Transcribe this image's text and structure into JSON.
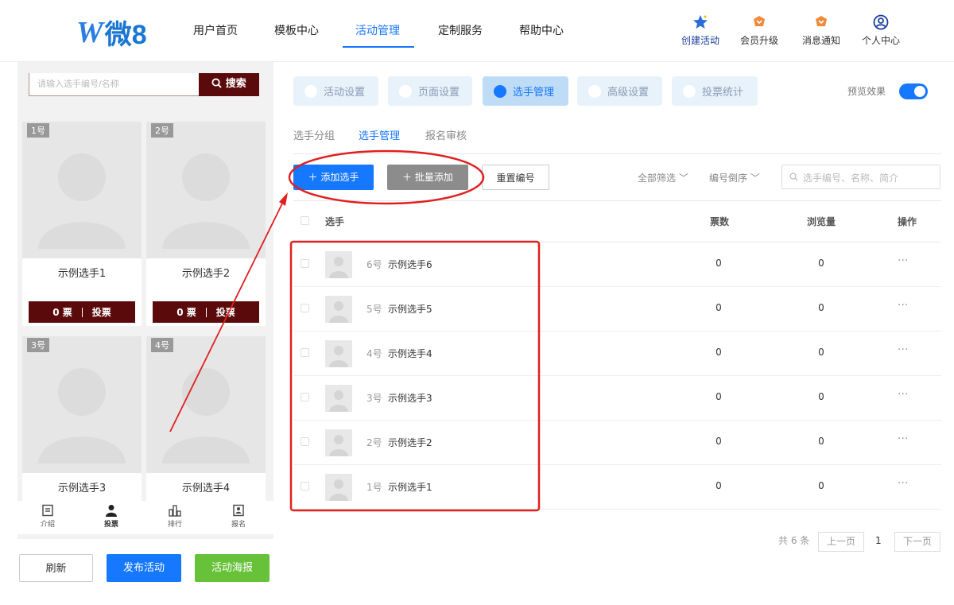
{
  "header": {
    "logo_w": "W",
    "logo_text": "微8",
    "nav": [
      "用户首页",
      "模板中心",
      "活动管理",
      "定制服务",
      "帮助中心"
    ],
    "active_nav": "活动管理",
    "icons": [
      {
        "label": "创建活动",
        "icon": "star-icon"
      },
      {
        "label": "会员升级",
        "icon": "crown-icon"
      },
      {
        "label": "消息通知",
        "icon": "bell-icon"
      },
      {
        "label": "个人中心",
        "icon": "user-icon"
      }
    ]
  },
  "preview": {
    "search_placeholder": "请输入选手编号/名称",
    "search_button": "搜索",
    "cards": [
      {
        "num": "1号",
        "name": "示例选手1",
        "votes": "0 票",
        "action": "投票"
      },
      {
        "num": "2号",
        "name": "示例选手2",
        "votes": "0 票",
        "action": "投票"
      },
      {
        "num": "3号",
        "name": "示例选手3"
      },
      {
        "num": "4号",
        "name": "示例选手4"
      }
    ],
    "bottom_nav": [
      "介绍",
      "投票",
      "排行",
      "报名"
    ],
    "active_bottom": "投票"
  },
  "left_actions": {
    "refresh": "刷新",
    "publish": "发布活动",
    "poster": "活动海报"
  },
  "tabs": [
    "活动设置",
    "页面设置",
    "选手管理",
    "高级设置",
    "投票统计"
  ],
  "active_tab": "选手管理",
  "preview_label": "预览效果",
  "subtabs": [
    "选手分组",
    "选手管理",
    "报名审核"
  ],
  "actions": {
    "add": "＋ 添加选手",
    "batch": "＋ 批量添加",
    "reset": "重置编号",
    "filter": "全部筛选 ﹀",
    "sort": "编号倒序 ﹀",
    "search_placeholder": "选手编号、名称、简介"
  },
  "table": {
    "headers": [
      "选手",
      "票数",
      "浏览量",
      "操作"
    ],
    "rows": [
      {
        "num": "6号",
        "name": "示例选手6",
        "votes": "0",
        "views": "0",
        "op": "···"
      },
      {
        "num": "5号",
        "name": "示例选手5",
        "votes": "0",
        "views": "0",
        "op": "···"
      },
      {
        "num": "4号",
        "name": "示例选手4",
        "votes": "0",
        "views": "0",
        "op": "···"
      },
      {
        "num": "3号",
        "name": "示例选手3",
        "votes": "0",
        "views": "0",
        "op": "···"
      },
      {
        "num": "2号",
        "name": "示例选手2",
        "votes": "0",
        "views": "0",
        "op": "···"
      },
      {
        "num": "1号",
        "name": "示例选手1",
        "votes": "0",
        "views": "0",
        "op": "···"
      }
    ]
  },
  "pagination": {
    "total": "共 6 条",
    "prev": "上一页",
    "current": "1",
    "next": "下一页"
  },
  "colors": {
    "accent": "#1677ff",
    "dark_red": "#5a0a0a",
    "green": "#67c23a",
    "annotation": "#e02020"
  }
}
